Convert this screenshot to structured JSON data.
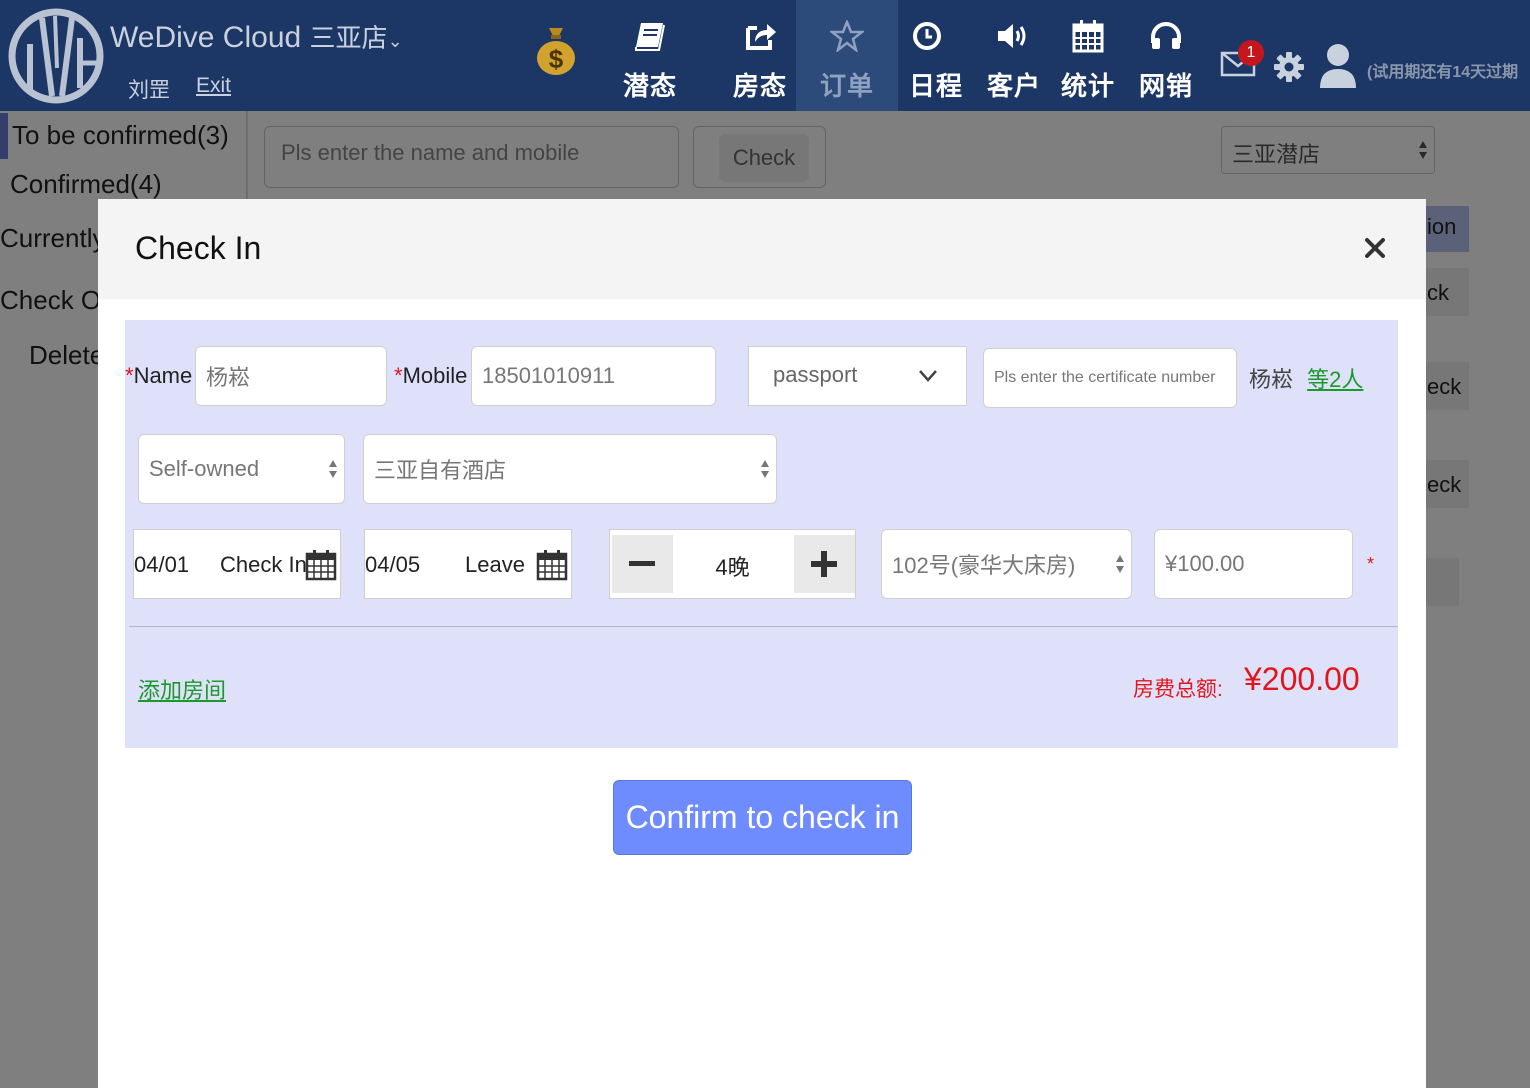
{
  "header": {
    "brand": "WeDive Cloud",
    "store": "三亚店",
    "user_name": "刘罡",
    "exit_label": "Exit",
    "nav": [
      "潜态",
      "房态",
      "订单",
      "日程",
      "客户",
      "统计",
      "网销"
    ],
    "active_nav": "订单",
    "mail_badge": "1",
    "trial_text": "(试用期还有14天过期"
  },
  "sidebar": {
    "items": [
      "To be confirmed(3)",
      "Confirmed(4)",
      "Currently",
      "Check Ou",
      "Delete"
    ]
  },
  "toolbar": {
    "search_placeholder": "Pls enter the name and mobile",
    "check_label": "Check",
    "store_select": "三亚潜店"
  },
  "background_fragments": [
    "ion",
    "ck",
    "eck",
    "eck"
  ],
  "modal": {
    "title": "Check In",
    "form": {
      "name_label": "Name",
      "name_value": "杨崧",
      "mobile_label": "Mobile",
      "mobile_value": "18501010911",
      "cert_type": "passport",
      "cert_placeholder": "Pls enter the certificate number",
      "guest_summary_name": "杨崧",
      "guest_summary_link": "等2人",
      "room_source": "Self-owned",
      "hotel": "三亚自有酒店",
      "checkin_date": "04/01",
      "checkin_label": "Check In",
      "leave_date": "04/05",
      "leave_label": "Leave",
      "nights": "4晚",
      "room": "102号(豪华大床房)",
      "price": "¥100.00",
      "required_mark": "*",
      "add_room": "添加房间",
      "total_label": "房费总额:",
      "total_value": "¥200.00"
    },
    "confirm_label": "Confirm to check in"
  }
}
